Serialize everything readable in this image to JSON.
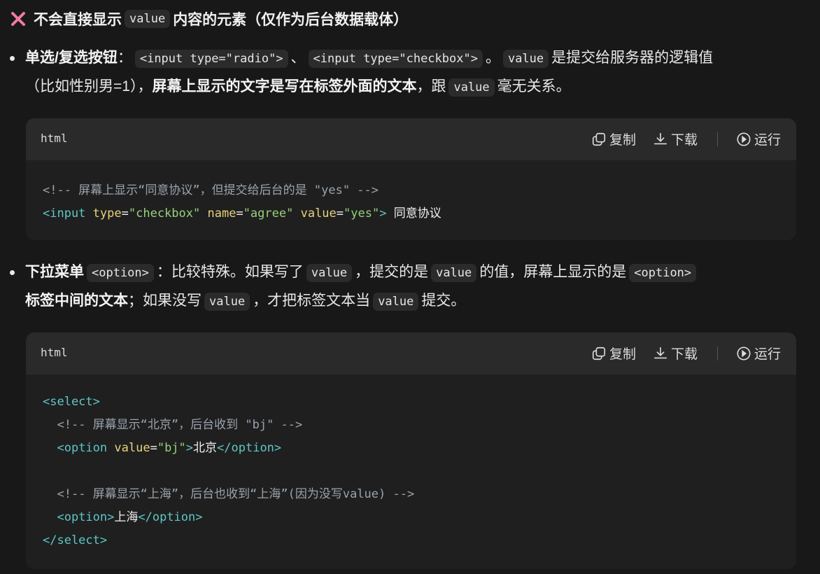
{
  "heading": {
    "text_before": "不会直接显示",
    "code": "value",
    "text_after": "内容的元素（仅作为后台数据载体）"
  },
  "bullet1": {
    "line1": {
      "bold": "单选/复选按钮",
      "colon": "：",
      "code1": "<input type=\"radio\">",
      "sep": "、",
      "code2": "<input type=\"checkbox\">",
      "mid": "。",
      "code3": "value",
      "tail": "是提交给服务器的逻辑值"
    },
    "line2": {
      "pre": "（比如性别男=1），",
      "bold": "屏幕上显示的文字是写在标签外面的文本",
      "mid": "，跟",
      "code": "value",
      "tail": "毫无关系。"
    }
  },
  "code_block_1": {
    "lang": "html",
    "actions": {
      "copy": "复制",
      "download": "下载",
      "run": "运行"
    },
    "lines": [
      {
        "comment": "<!-- 屏幕上显示“同意协议”，但提交给后台的是 \"yes\" -->"
      },
      {
        "tag_open": "<input",
        "attr1_name": "type",
        "attr1_value": "\"checkbox\"",
        "attr2_name": "name",
        "attr2_value": "\"agree\"",
        "attr3_name": "value",
        "attr3_value": "\"yes\"",
        "tag_close": ">",
        "text": "同意协议"
      }
    ]
  },
  "bullet2": {
    "line1": {
      "bold": "下拉菜单",
      "code1": "<option>",
      "text1": "：比较特殊。如果写了",
      "code2": "value",
      "text2": "，提交的是",
      "code3": "value",
      "text3": "的值，屏幕上显示的是",
      "code4": "<option>"
    },
    "line2": {
      "bold": "标签中间的文本",
      "text1": "；如果没写",
      "code1": "value",
      "text2": "，才把标签文本当",
      "code2": "value",
      "text3": "提交。"
    }
  },
  "code_block_2": {
    "lang": "html",
    "actions": {
      "copy": "复制",
      "download": "下载",
      "run": "运行"
    },
    "lines": {
      "select_open": "<select>",
      "comment1": "<!-- 屏幕显示“北京”，后台收到 \"bj\" -->",
      "option1_open": "<option",
      "option1_attr_name": "value",
      "option1_attr_value": "\"bj\"",
      "option1_gt": ">",
      "option1_text": "北京",
      "option1_close": "</option>",
      "comment2": "<!-- 屏幕显示“上海”，后台也收到“上海”(因为没写value) -->",
      "option2_open": "<option>",
      "option2_text": "上海",
      "option2_close": "</option>",
      "select_close": "</select>"
    }
  },
  "colors": {
    "background": "#181818",
    "code_header": "#2a2a2a",
    "code_body": "#1f1f1f",
    "tag": "#5fc6c6",
    "attr": "#e7d27b",
    "string": "#99d07a",
    "comment": "#9aa3ad",
    "x_icon": "#f07ba0"
  },
  "icons": {
    "heading": "x-mark-icon",
    "copy": "copy-icon",
    "download": "download-icon",
    "run": "play-circle-icon"
  }
}
